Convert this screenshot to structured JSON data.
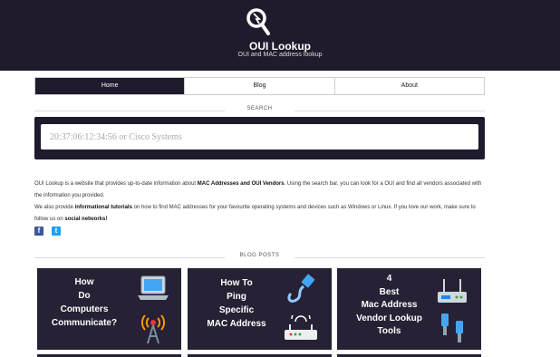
{
  "header": {
    "title": "OUI Lookup",
    "subtitle": "OUI and MAC address lookup",
    "logo_icon": "magnifier-icon"
  },
  "nav": {
    "tabs": [
      {
        "label": "Home",
        "active": true
      },
      {
        "label": "Blog",
        "active": false
      },
      {
        "label": "About",
        "active": false
      }
    ]
  },
  "search": {
    "section_label": "SEARCH",
    "placeholder": "20:37:06:12:34:56 or Cisco Systems"
  },
  "about": {
    "p1_a": "OUI Lookup is a website that provides up-to-date information about ",
    "p1_b": "MAC Addresses and OUI Vendors",
    "p1_c": ". Using the search bar, you can look for a OUI and find all vendors associated with the information you provided.",
    "p2_a": "We also provide ",
    "p2_b": "informational tutorials",
    "p2_c": " on how to find MAC addresses for your favourite operating systems and devices such as Windows or Linux. If you love our work, make sure to follow us on ",
    "p2_d": "social networks!"
  },
  "socials": [
    {
      "icon": "facebook-icon",
      "glyph": "f"
    },
    {
      "icon": "twitter-icon",
      "glyph": "t"
    }
  ],
  "blog": {
    "section_label": "BLOG POSTS",
    "posts": [
      {
        "title": "How\nDo\nComputers\nCommunicate?",
        "icons": [
          "laptop-icon",
          "wireless-signal-icon"
        ]
      },
      {
        "title": "How To\nPing\nSpecific\nMAC Address",
        "icons": [
          "ethernet-cable-icon",
          "router-icon"
        ]
      },
      {
        "title": "4\nBest\nMac Address\nVendor Lookup\nTools",
        "icons": [
          "router-icon",
          "network-connectors-icon"
        ]
      }
    ]
  },
  "colors": {
    "header_bg": "#201a2d",
    "card_bg": "#262134"
  }
}
